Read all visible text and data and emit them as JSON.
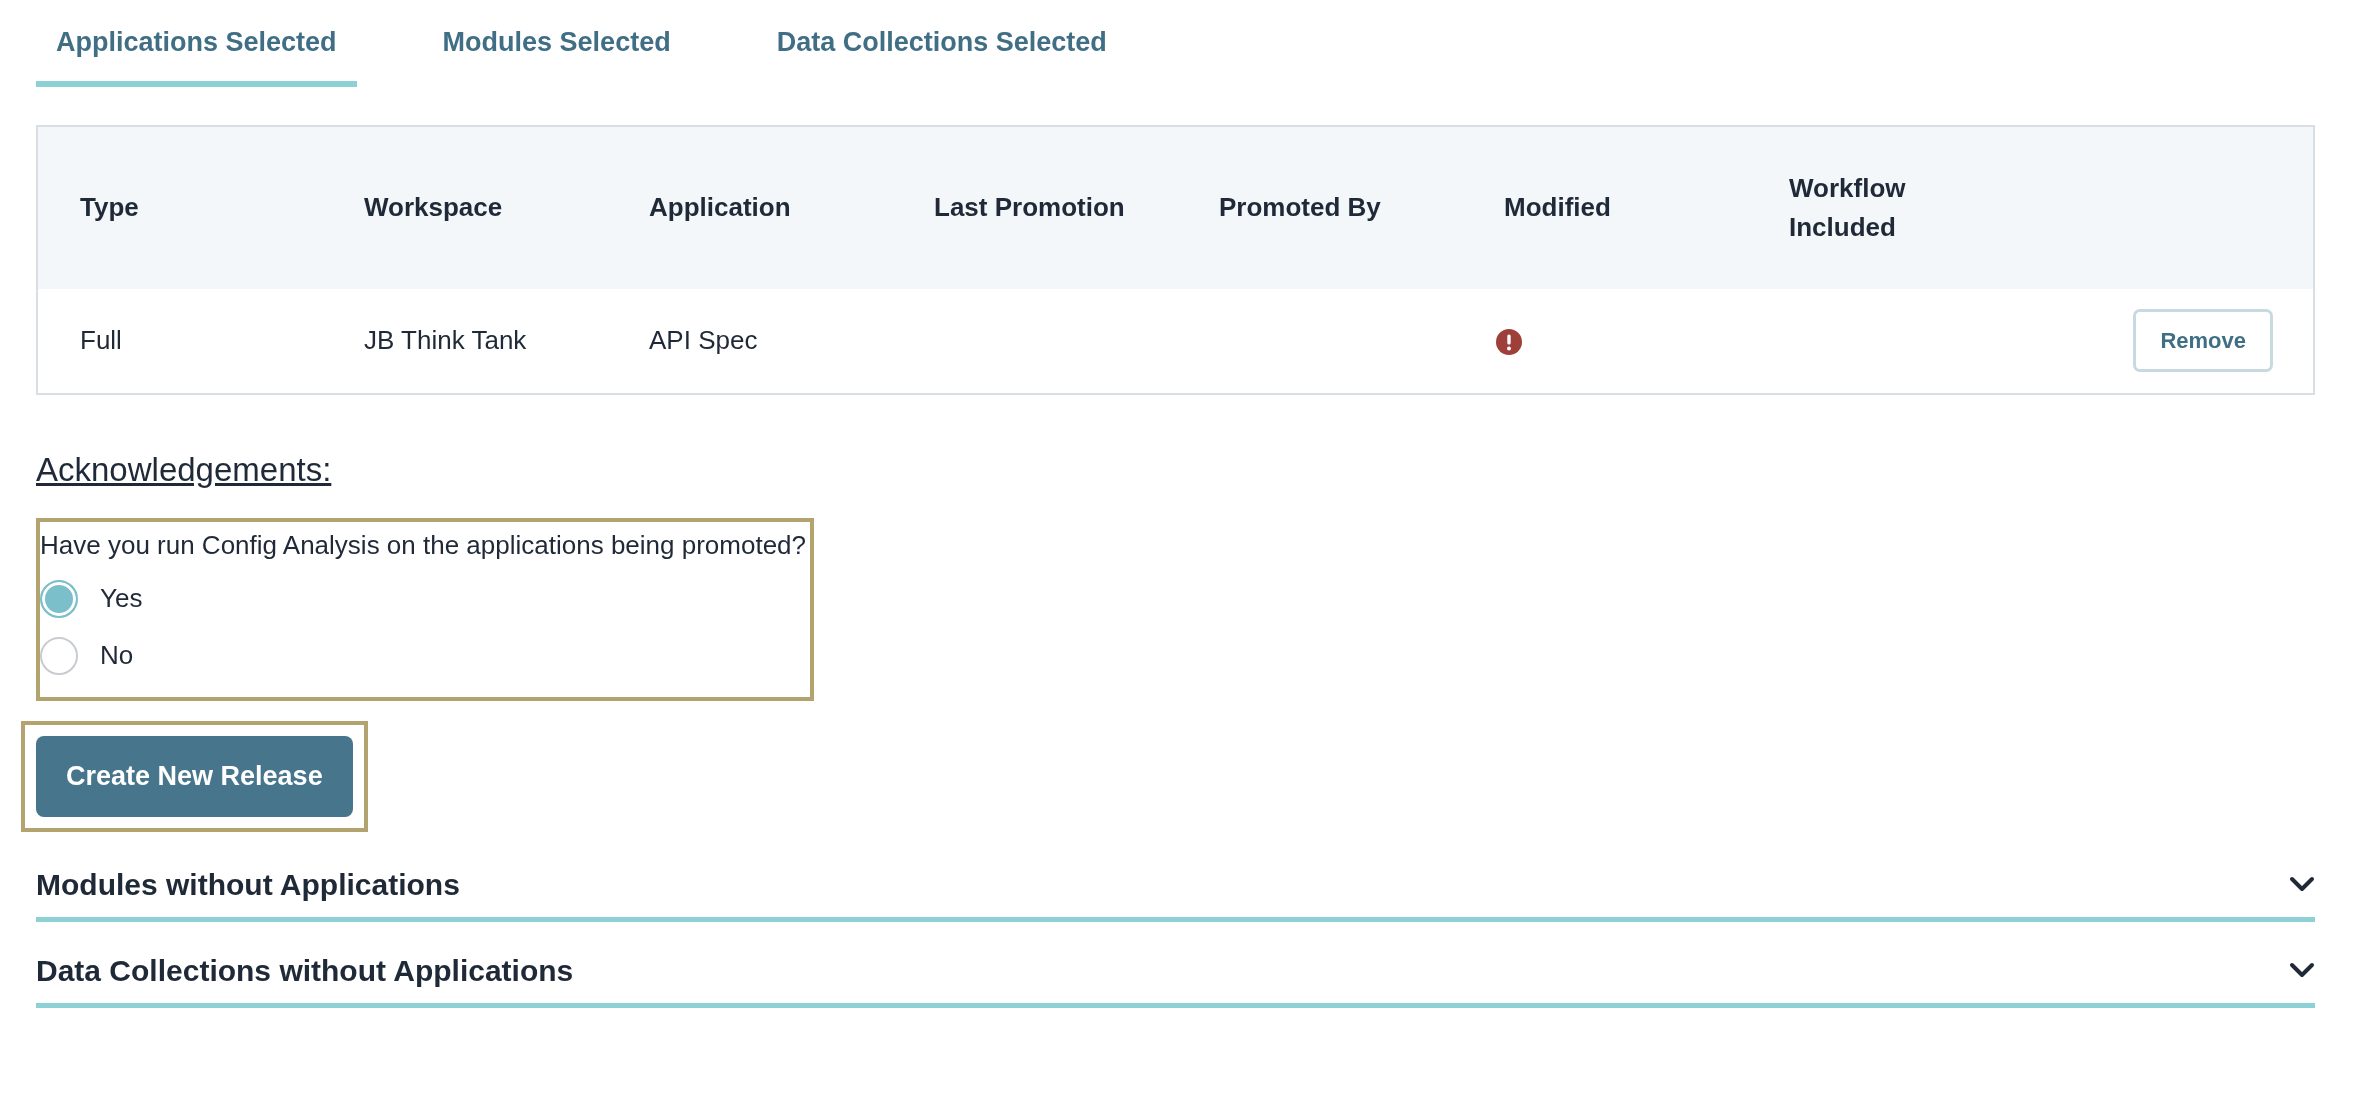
{
  "tabs": [
    {
      "label": "Applications Selected",
      "selected": true
    },
    {
      "label": "Modules Selected",
      "selected": false
    },
    {
      "label": "Data Collections Selected",
      "selected": false
    }
  ],
  "table": {
    "columns": [
      "Type",
      "Workspace",
      "Application",
      "Last Promotion",
      "Promoted By",
      "Modified",
      "Workflow Included"
    ],
    "rows": [
      {
        "type": "Full",
        "workspace": "JB Think Tank",
        "application": "API Spec",
        "modified": true,
        "action": "Remove"
      }
    ]
  },
  "acknowledgements": {
    "title": "Acknowledgements:",
    "question": "Have you run Config Analysis on the applications being promoted?",
    "options": [
      {
        "label": "Yes",
        "selected": true
      },
      {
        "label": "No",
        "selected": false
      }
    ]
  },
  "primary_button": "Create New Release",
  "sections": [
    {
      "title": "Modules without Applications",
      "expanded": false
    },
    {
      "title": "Data Collections without Applications",
      "expanded": false
    }
  ]
}
